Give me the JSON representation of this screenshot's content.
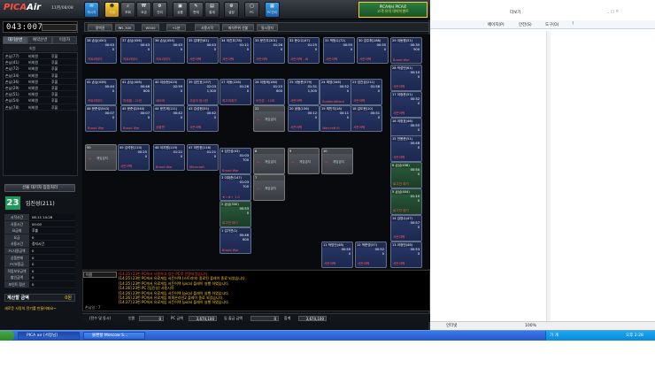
{
  "app": {
    "logo_pica": "PICA",
    "logo_air": "Air",
    "date": "11月/08/08",
    "clock": "043:007",
    "toolbar_icons": [
      {
        "label": "메시지",
        "icon": "message-icon"
      },
      {
        "label": "식별",
        "icon": "id-icon"
      },
      {
        "label": "조회",
        "icon": "search-icon"
      },
      {
        "label": "요금",
        "icon": "fee-icon"
      },
      {
        "label": "관리",
        "icon": "manage-icon"
      },
      {
        "label": "상품",
        "icon": "goods-icon"
      },
      {
        "label": "판매",
        "icon": "sale-icon"
      },
      {
        "label": "통계",
        "icon": "stats-icon"
      },
      {
        "label": "설정",
        "icon": "settings-icon"
      },
      {
        "label": "PC",
        "icon": "pc-icon"
      },
      {
        "label": "PC관리",
        "icon": "pc-manage-icon"
      }
    ],
    "ad": {
      "line1": "PICA에서 PICA로",
      "line2": "고객 유치 대박이벤트",
      "line3": "PC방매출 증대"
    }
  },
  "left": {
    "tabs": [
      "대기순번",
      "예약순번",
      "이용자"
    ],
    "list_header": "회원",
    "members": [
      {
        "name": "손님(77)",
        "type": "비회원",
        "status": "후불"
      },
      {
        "name": "손님(41)",
        "type": "비회원",
        "status": "후불"
      },
      {
        "name": "손님(72)",
        "type": "비회원",
        "status": "후불"
      },
      {
        "name": "손님(34)",
        "type": "비회원",
        "status": "후불"
      },
      {
        "name": "손님(36)",
        "type": "비회원",
        "status": "후불"
      },
      {
        "name": "손님(29)",
        "type": "비회원",
        "status": "후불"
      },
      {
        "name": "손님(51)",
        "type": "비회원",
        "status": "후불"
      },
      {
        "name": "손님(54)",
        "type": "비회원",
        "status": "후불"
      },
      {
        "name": "손님(78)",
        "type": "비회원",
        "status": "후불"
      }
    ],
    "wait_button": "선불 대기자 입장처리",
    "seat_number": "23",
    "seat_user": "임진성(211)",
    "info_rows": [
      {
        "k": "시작시간",
        "v": "08-11 14:28"
      },
      {
        "k": "사용시간",
        "v": "00:00"
      },
      {
        "k": "요금제",
        "v": "후불"
      },
      {
        "k": "요금",
        "v": "0"
      },
      {
        "k": "사용시간",
        "v": "정지시간"
      },
      {
        "k": "PC사용금액",
        "v": "0"
      },
      {
        "k": "상품판매",
        "v": "0"
      },
      {
        "k": "PC보증금",
        "v": "0"
      },
      {
        "k": "적립보유금액",
        "v": "0"
      },
      {
        "k": "할인금액",
        "v": "0"
      },
      {
        "k": "포인트 정산",
        "v": "0"
      }
    ],
    "total_label": "계산할 금액",
    "total_value": "0원",
    "notice": "새로운 사랑의 전기를 만들어봐요~"
  },
  "toolbar2": [
    "정액권",
    "₩1,300",
    "W500",
    "+1분",
    "사용시작",
    "좌석주위 선불",
    "일시정지"
  ],
  "seats": [
    {
      "no": "38",
      "user": "손님(450)",
      "t": "00:43",
      "amt": "0",
      "game": "카트라이더"
    },
    {
      "no": "37",
      "user": "손님(456)",
      "t": "00:43",
      "amt": "0",
      "game": "카트라이더"
    },
    {
      "no": "36",
      "user": "손님(454)",
      "t": "00:43",
      "amt": "0",
      "game": "카트라이더"
    },
    {
      "no": "35",
      "user": "김재민(61)",
      "t": "00:43",
      "amt": "0",
      "game": "서든어택"
    },
    {
      "no": "34",
      "user": "이진우(78)",
      "t": "01:11",
      "amt": "0",
      "game": "서든어택"
    },
    {
      "no": "33",
      "user": "문진우(301)",
      "t": "01:26",
      "amt": "0",
      "game": "서든어택"
    },
    {
      "no": "32",
      "user": "문수수(47)",
      "t": "01:25",
      "amt": "0",
      "game": "서든어택 - W"
    },
    {
      "no": "31",
      "user": "박범수(72)",
      "t": "00:55",
      "amt": "0",
      "game": "서든어택"
    },
    {
      "no": "30",
      "user": "김주휘(188)",
      "t": "00:35",
      "amt": "0",
      "game": "서든어택"
    },
    {
      "no": "29",
      "user": "이동원(51)",
      "t": "00:35",
      "amt": "900",
      "game": "Brood War"
    },
    {
      "no": "42",
      "user": "손님(436)",
      "t": "00:44",
      "amt": "0",
      "game": "카트라이더"
    },
    {
      "no": "41",
      "user": "손님(408)",
      "t": "00:46",
      "amt": "800",
      "game": "마계열 - 21단"
    },
    {
      "no": "40",
      "user": "이승현(423)",
      "t": "02:59",
      "amt": "0",
      "game": "네이버"
    },
    {
      "no": "39",
      "user": "김인호(157)",
      "t": "02:03",
      "amt": "1,300",
      "game": "고급이 잠시만"
    },
    {
      "no": "27",
      "user": "이동(226)",
      "t": "01:26",
      "amt": "0",
      "game": "최고의위기"
    },
    {
      "no": "26",
      "user": "이정제(180)",
      "t": "01:15",
      "amt": "600",
      "game": "이건은 - 11바"
    },
    {
      "no": "25",
      "user": "서동준(579)",
      "t": "01:31",
      "amt": "1,500",
      "game": "서든어택"
    },
    {
      "no": "24",
      "user": "최영(346)",
      "t": "00:52",
      "amt": "0",
      "game": "SuddenAttack"
    },
    {
      "no": "23",
      "user": "임진성(211)",
      "t": "01:58",
      "amt": "0",
      "game": "서든어택"
    },
    {
      "no": "28",
      "user": "박성민(61)",
      "t": "00:10",
      "amt": "0",
      "game": "서든어택"
    },
    {
      "no": "46",
      "user": "문준성(543)",
      "t": "00:07",
      "amt": "0",
      "game": "Brood War"
    },
    {
      "no": "45",
      "user": "문준성(540)",
      "t": "00:07",
      "amt": "0",
      "game": "Brood War"
    },
    {
      "no": "44",
      "user": "문진재(111)",
      "t": "00:42",
      "amt": "0",
      "game": "상황판"
    },
    {
      "no": "43",
      "user": "김성현(55)",
      "t": "00:42",
      "amt": "0",
      "game": "서든어택"
    },
    {
      "no": "21",
      "user": "조민석(4)",
      "t": "00:42",
      "amt": "0",
      "game": "Brood War"
    },
    {
      "no": "20",
      "user": "공정(136)",
      "t": "00:12",
      "amt": "0",
      "game": "서든어택"
    },
    {
      "no": "19",
      "user": "최민석(18)",
      "t": "00:11",
      "amt": "0",
      "game": "Warcraft III"
    },
    {
      "no": "18",
      "user": "김도현(10)",
      "t": "00:51",
      "amt": "0",
      "game": "서든어택"
    },
    {
      "no": "17",
      "user": "이정준(51)",
      "t": "00:32",
      "amt": "0",
      "game": "서든어택"
    },
    {
      "no": "49",
      "user": "김석현(110)",
      "t": "00:25",
      "amt": "0",
      "game": "서든어택"
    },
    {
      "no": "48",
      "user": "이지원(119)",
      "t": "01:21",
      "amt": "0",
      "game": "Brood War"
    },
    {
      "no": "47",
      "user": "이민한(116)",
      "t": "01:21",
      "amt": "0",
      "game": "Minecraft"
    },
    {
      "no": "16",
      "user": "이정호(46)",
      "t": "00:55",
      "amt": "0",
      "game": "서든어택"
    },
    {
      "no": "15",
      "user": "전용준(51)",
      "t": "00:48",
      "amt": "0",
      "game": "서든어택"
    },
    {
      "no": "4",
      "user": "임진성(43)",
      "t": "01:03",
      "amt": "700",
      "game": "Brood War"
    },
    {
      "no": "3",
      "user": "이대준(147)",
      "t": "01:03",
      "amt": "700",
      "game": "★☆★☆ 1.0"
    },
    {
      "no": "2",
      "user": "손님(330)",
      "t": "00:53",
      "amt": "0",
      "game": "로그인 대기"
    },
    {
      "no": "1",
      "user": "김가연(1)",
      "t": "00:46",
      "amt": "600",
      "game": "Brood War"
    },
    {
      "no": "6",
      "user": "손님(438)",
      "t": "00:50",
      "amt": "0",
      "game": "로그인 대기"
    },
    {
      "no": "5",
      "user": "손님(404)",
      "t": "01:10",
      "amt": "0",
      "game": "로그인 대기"
    },
    {
      "no": "14",
      "user": "김영수(47)",
      "t": "00:57",
      "amt": "0",
      "game": "서든어택"
    },
    {
      "no": "13",
      "user": "이정민(48)",
      "t": "00:53",
      "amt": "0",
      "game": "서든어택"
    },
    {
      "no": "12",
      "user": "박준영(37)",
      "t": "00:52",
      "amt": "0",
      "game": "서든어택"
    },
    {
      "no": "11",
      "user": "박영진(48)",
      "t": "00:50",
      "amt": "0",
      "game": "서든어택"
    }
  ],
  "empty_seats": [
    {
      "no": "22",
      "label": "게임금지"
    },
    {
      "no": "50",
      "label": "게임금지"
    },
    {
      "no": "10",
      "label": "게임금지"
    },
    {
      "no": "9",
      "label": "게임금지"
    },
    {
      "no": "8",
      "label": "게임금지"
    },
    {
      "no": "7",
      "label": "게임금지"
    }
  ],
  "log": {
    "select": "이용",
    "status": "손님일 : 7",
    "lines": [
      {
        "text": "[14:25] 23번 PC에서 사용하고 있는 PC로 전환되었습니다.",
        "red": true
      },
      {
        "text": "[14:25] 23번 PC에서 유료게임 서든어택 (스트리머) 종료된 플레이 종료 되었습니다.",
        "red": false
      },
      {
        "text": "[14:25] 23번 PC에서 유료게임 서든어택 (pica) 플레이 실행 하였습니다.",
        "red": false
      },
      {
        "text": "[14:26] 23번 PC [임진성] 사용시작",
        "red": false
      },
      {
        "text": "[14:26] 23번 PC에서 유료게임 서든어택 (pica) 플레이 실행 하였습니다.",
        "red": false
      },
      {
        "text": "[14:26] 23번 PC에서 유료게임 피파온라인2 플레이 종료 되었습니다.",
        "red": false
      },
      {
        "text": "[14:27] 23번 PC에서 유료게임 서든어택 (pica) 플레이 실행 하였습니다.",
        "red": false
      }
    ]
  },
  "bottom": {
    "label1": "(전수 및 동시)",
    "label2": "인원",
    "v2": "0",
    "label3": "PC 금액",
    "v3": "3,674,100",
    "label4": "입 출금 금액",
    "v4": "0",
    "label5": "합계",
    "v5": "3,674,100"
  },
  "ie": {
    "menu": [
      "더보기",
      "페이지(P)",
      "안전(S)",
      "도구(O)"
    ],
    "zone": "인터넷",
    "zoom": "100%"
  },
  "taskbar": {
    "start": "시작",
    "tasks": [
      "PICA air [서정님]",
      "불편할 Moscow S..."
    ],
    "tray_time": "오후 2:28",
    "tray_lang": "가 개"
  }
}
